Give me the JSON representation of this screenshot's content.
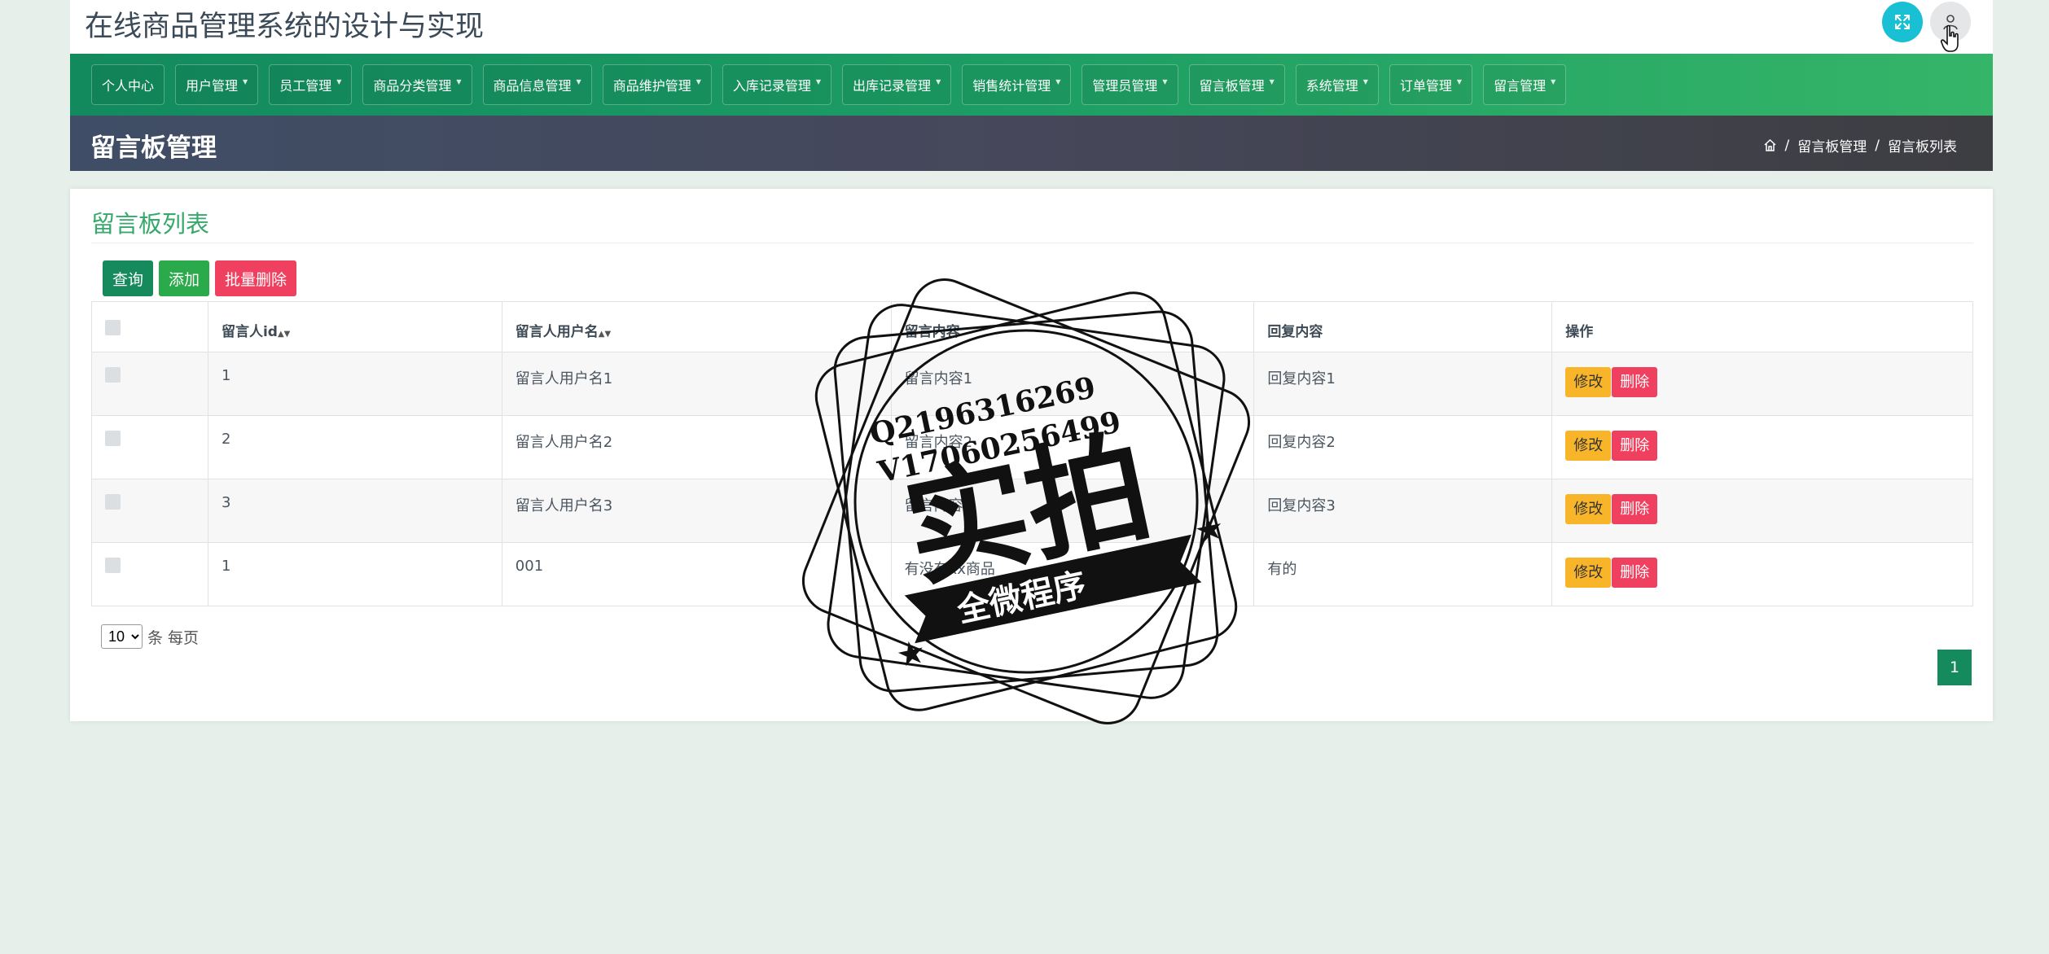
{
  "app": {
    "title": "在线商品管理系统的设计与实现"
  },
  "nav": {
    "items": [
      {
        "label": "个人中心",
        "dropdown": false
      },
      {
        "label": "用户管理",
        "dropdown": true
      },
      {
        "label": "员工管理",
        "dropdown": true
      },
      {
        "label": "商品分类管理",
        "dropdown": true
      },
      {
        "label": "商品信息管理",
        "dropdown": true
      },
      {
        "label": "商品维护管理",
        "dropdown": true
      },
      {
        "label": "入库记录管理",
        "dropdown": true
      },
      {
        "label": "出库记录管理",
        "dropdown": true
      },
      {
        "label": "销售统计管理",
        "dropdown": true
      },
      {
        "label": "管理员管理",
        "dropdown": true
      },
      {
        "label": "留言板管理",
        "dropdown": true
      },
      {
        "label": "系统管理",
        "dropdown": true
      },
      {
        "label": "订单管理",
        "dropdown": true
      },
      {
        "label": "留言管理",
        "dropdown": true
      }
    ]
  },
  "header": {
    "page_title": "留言板管理",
    "breadcrumb": [
      "留言板管理",
      "留言板列表"
    ]
  },
  "card": {
    "title": "留言板列表",
    "buttons": {
      "query": "查询",
      "add": "添加",
      "batch_delete": "批量删除"
    }
  },
  "table": {
    "columns": [
      "留言人id",
      "留言人用户名",
      "留言内容",
      "回复内容",
      "操作"
    ],
    "rows": [
      {
        "id": "1",
        "username": "留言人用户名1",
        "content": "留言内容1",
        "reply": "回复内容1"
      },
      {
        "id": "2",
        "username": "留言人用户名2",
        "content": "留言内容2",
        "reply": "回复内容2"
      },
      {
        "id": "3",
        "username": "留言人用户名3",
        "content": "留言内容3",
        "reply": "回复内容3"
      },
      {
        "id": "1",
        "username": "001",
        "content": "有没有xx商品",
        "reply": "有的"
      }
    ],
    "actions": {
      "edit": "修改",
      "delete": "删除"
    }
  },
  "pager": {
    "page_size": "10",
    "page_size_options": [
      "10"
    ],
    "per_page_label": "条 每页",
    "current_page": "1"
  },
  "watermark": {
    "line1": "Q2196316269",
    "line2": "V17060256499",
    "main": "实拍",
    "sub": "全微程序"
  },
  "colors": {
    "nav_green": "#1d9e64",
    "title_green": "#37a86b",
    "query": "#168a5d",
    "add": "#2aaa4a",
    "danger": "#f0405f",
    "warning": "#f8b52a",
    "fullscreen": "#19bfd3"
  }
}
